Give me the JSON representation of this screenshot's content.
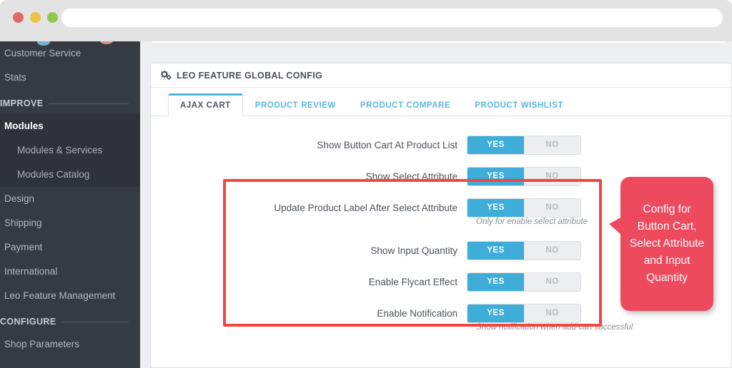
{
  "browser": {
    "url_value": "",
    "url_placeholder": "",
    "window_buttons": [
      "close-red",
      "minimize-yellow",
      "maximize-green"
    ]
  },
  "sidebar": {
    "items": [
      {
        "label": "Customer Service",
        "type": "link",
        "active": false
      },
      {
        "label": "Stats",
        "type": "link",
        "active": false
      }
    ],
    "sections": [
      {
        "title": "IMPROVE",
        "items": [
          {
            "label": "Modules",
            "type": "link",
            "active": true
          },
          {
            "label": "Modules & Services",
            "type": "child",
            "active": false
          },
          {
            "label": "Modules Catalog",
            "type": "child",
            "active": false
          },
          {
            "label": "Design",
            "type": "link",
            "active": false
          },
          {
            "label": "Shipping",
            "type": "link",
            "active": false
          },
          {
            "label": "Payment",
            "type": "link",
            "active": false
          },
          {
            "label": "International",
            "type": "link",
            "active": false
          },
          {
            "label": "Leo Feature Management",
            "type": "link",
            "active": false
          }
        ]
      },
      {
        "title": "CONFIGURE",
        "items": [
          {
            "label": "Shop Parameters",
            "type": "link",
            "active": false
          }
        ]
      }
    ]
  },
  "panel": {
    "title": "LEO FEATURE GLOBAL CONFIG",
    "icon": "cogs-icon",
    "tabs": [
      {
        "label": "AJAX CART",
        "active": true
      },
      {
        "label": "PRODUCT REVIEW",
        "active": false
      },
      {
        "label": "PRODUCT COMPARE",
        "active": false
      },
      {
        "label": "PRODUCT WISHLIST",
        "active": false
      }
    ],
    "rows": [
      {
        "label": "Show Button Cart At Product List",
        "value": "YES",
        "yes_label": "YES",
        "no_label": "NO",
        "help": ""
      },
      {
        "label": "Show Select Attribute",
        "value": "YES",
        "yes_label": "YES",
        "no_label": "NO",
        "help": ""
      },
      {
        "label": "Update Product Label After Select Attribute",
        "value": "YES",
        "yes_label": "YES",
        "no_label": "NO",
        "help": "Only for enable select attribute"
      },
      {
        "label": "Show Input Quantity",
        "value": "YES",
        "yes_label": "YES",
        "no_label": "NO",
        "help": ""
      },
      {
        "label": "Enable Flycart Effect",
        "value": "YES",
        "yes_label": "YES",
        "no_label": "NO",
        "help": ""
      },
      {
        "label": "Enable Notification",
        "value": "YES",
        "yes_label": "YES",
        "no_label": "NO",
        "help": "Show notification when add cart successful"
      }
    ]
  },
  "annotation": {
    "callout_text": "Config for Button Cart, Select Attribute and Input Quantity",
    "callout_color": "#ee4a5e",
    "highlight_color": "#f4453f"
  },
  "colors": {
    "sidebar_bg": "#363a41",
    "toggle_on": "#3eadd8",
    "tab_active_underline": "#4fb6dd",
    "content_bg": "#edeff1"
  }
}
